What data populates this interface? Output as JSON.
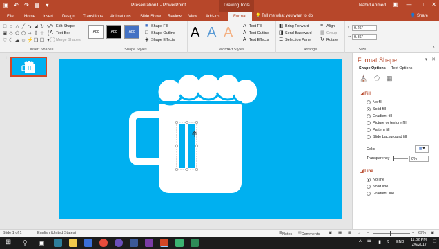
{
  "titlebar": {
    "title": "Presentation1 - PowerPoint",
    "context_tab": "Drawing Tools",
    "user": "Nahid Ahmed",
    "qat_icons": [
      "save-icon",
      "undo-icon",
      "redo-icon",
      "present-icon",
      "customize-icon"
    ]
  },
  "tabs": [
    {
      "label": "File"
    },
    {
      "label": "Home"
    },
    {
      "label": "Insert"
    },
    {
      "label": "Design"
    },
    {
      "label": "Transitions"
    },
    {
      "label": "Animations"
    },
    {
      "label": "Slide Show"
    },
    {
      "label": "Review"
    },
    {
      "label": "View"
    },
    {
      "label": "Add-ins"
    },
    {
      "label": "Format",
      "active": true
    }
  ],
  "tell_me": "Tell me what you want to do",
  "share": "Share",
  "ribbon": {
    "insert_shapes": {
      "label": "Insert Shapes",
      "edit_shape": "Edit Shape",
      "text_box": "Text Box",
      "merge_shapes": "Merge Shapes"
    },
    "shape_styles": {
      "label": "Shape Styles",
      "style1": "Abc",
      "style2": "Abc",
      "style3": "Abc",
      "fill": "Shape Fill",
      "outline": "Shape Outline",
      "effects": "Shape Effects"
    },
    "wordart": {
      "label": "WordArt Styles",
      "a1": "A",
      "a2": "A",
      "a3": "A",
      "text_fill": "Text Fill",
      "text_outline": "Text Outline",
      "text_effects": "Text Effects"
    },
    "arrange": {
      "label": "Arrange",
      "bring_forward": "Bring Forward",
      "send_backward": "Send Backward",
      "selection_pane": "Selection Pane",
      "align": "Align",
      "group": "Group",
      "rotate": "Rotate"
    },
    "size": {
      "label": "Size",
      "height": "0.26\"",
      "width": "0.86\""
    }
  },
  "sidebar": {
    "slide_number": "1"
  },
  "format_pane": {
    "title": "Format Shape",
    "tab_shape": "Shape Options",
    "tab_text": "Text Options",
    "fill_section": "Fill",
    "fill_options": [
      {
        "label": "No fill",
        "selected": false
      },
      {
        "label": "Solid fill",
        "selected": true
      },
      {
        "label": "Gradient fill",
        "selected": false
      },
      {
        "label": "Picture or texture fill",
        "selected": false
      },
      {
        "label": "Pattern fill",
        "selected": false
      }
    ],
    "slide_bg_fill": "Slide background fill",
    "color_label": "Color",
    "transparency_label": "Transparency",
    "transparency_value": "0%",
    "line_section": "Line",
    "line_options": [
      {
        "label": "No line",
        "selected": true
      },
      {
        "label": "Solid line",
        "selected": false
      },
      {
        "label": "Gradient line",
        "selected": false
      }
    ]
  },
  "status": {
    "slide_info": "Slide 1 of 1",
    "language": "English (United States)",
    "notes": "Notes",
    "comments": "Comments",
    "zoom": "69%"
  },
  "taskbar": {
    "lang": "ENG",
    "time": "11:02 PM",
    "date": "2/6/2017"
  },
  "colors": {
    "accent": "#b7472a",
    "slide_bg": "#00b0f0",
    "shape_fill": "#ffffff"
  }
}
